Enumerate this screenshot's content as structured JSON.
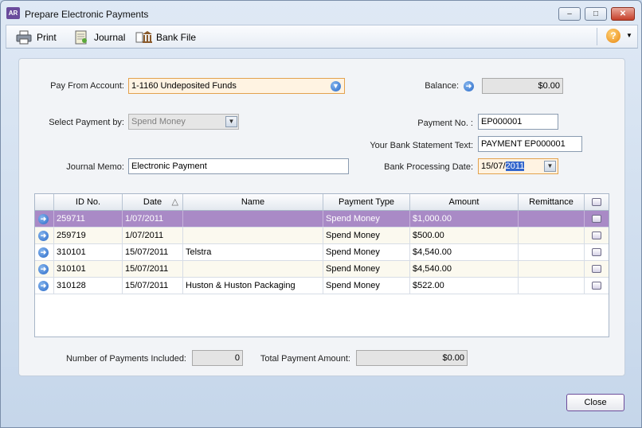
{
  "window": {
    "title": "Prepare Electronic Payments",
    "app_icon": "AR",
    "controls": [
      "minimize",
      "maximize",
      "close"
    ]
  },
  "toolbar": {
    "print_label": "Print",
    "journal_label": "Journal",
    "bankfile_label": "Bank File",
    "help_glyph": "?"
  },
  "form": {
    "pay_from_label": "Pay From Account:",
    "pay_from_value": "1-1160 Undeposited Funds",
    "balance_label": "Balance:",
    "balance_value": "$0.00",
    "select_by_label": "Select Payment by:",
    "select_by_value": "Spend Money",
    "payment_no_label": "Payment No. :",
    "payment_no_value": "EP000001",
    "bank_stmt_label": "Your Bank Statement Text:",
    "bank_stmt_value": "PAYMENT EP000001",
    "memo_label": "Journal Memo:",
    "memo_value": "Electronic Payment",
    "proc_date_label": "Bank Processing Date:",
    "proc_date_prefix": "15/07/",
    "proc_date_selected": "2011"
  },
  "table": {
    "columns": [
      "ID No.",
      "Date",
      "Name",
      "Payment Type",
      "Amount",
      "Remittance"
    ],
    "sort_indicator": "△",
    "rows": [
      {
        "id": "259711",
        "date": "1/07/2011",
        "name": "",
        "type": "Spend Money",
        "amount": "$1,000.00",
        "remittance": ""
      },
      {
        "id": "259719",
        "date": "1/07/2011",
        "name": "",
        "type": "Spend Money",
        "amount": "$500.00",
        "remittance": ""
      },
      {
        "id": "310101",
        "date": "15/07/2011",
        "name": "Telstra",
        "type": "Spend Money",
        "amount": "$4,540.00",
        "remittance": ""
      },
      {
        "id": "310101",
        "date": "15/07/2011",
        "name": "",
        "type": "Spend Money",
        "amount": "$4,540.00",
        "remittance": ""
      },
      {
        "id": "310128",
        "date": "15/07/2011",
        "name": "Huston & Huston Packaging",
        "type": "Spend Money",
        "amount": "$522.00",
        "remittance": ""
      }
    ],
    "selected_row": 0
  },
  "footer": {
    "count_label": "Number of Payments Included:",
    "count_value": "0",
    "total_label": "Total Payment Amount:",
    "total_value": "$0.00",
    "close_label": "Close"
  },
  "colors": {
    "selected_row": "#a98ac6",
    "highlight_field": "#fff3e2",
    "arrow_icon": "#2a6ac8"
  }
}
